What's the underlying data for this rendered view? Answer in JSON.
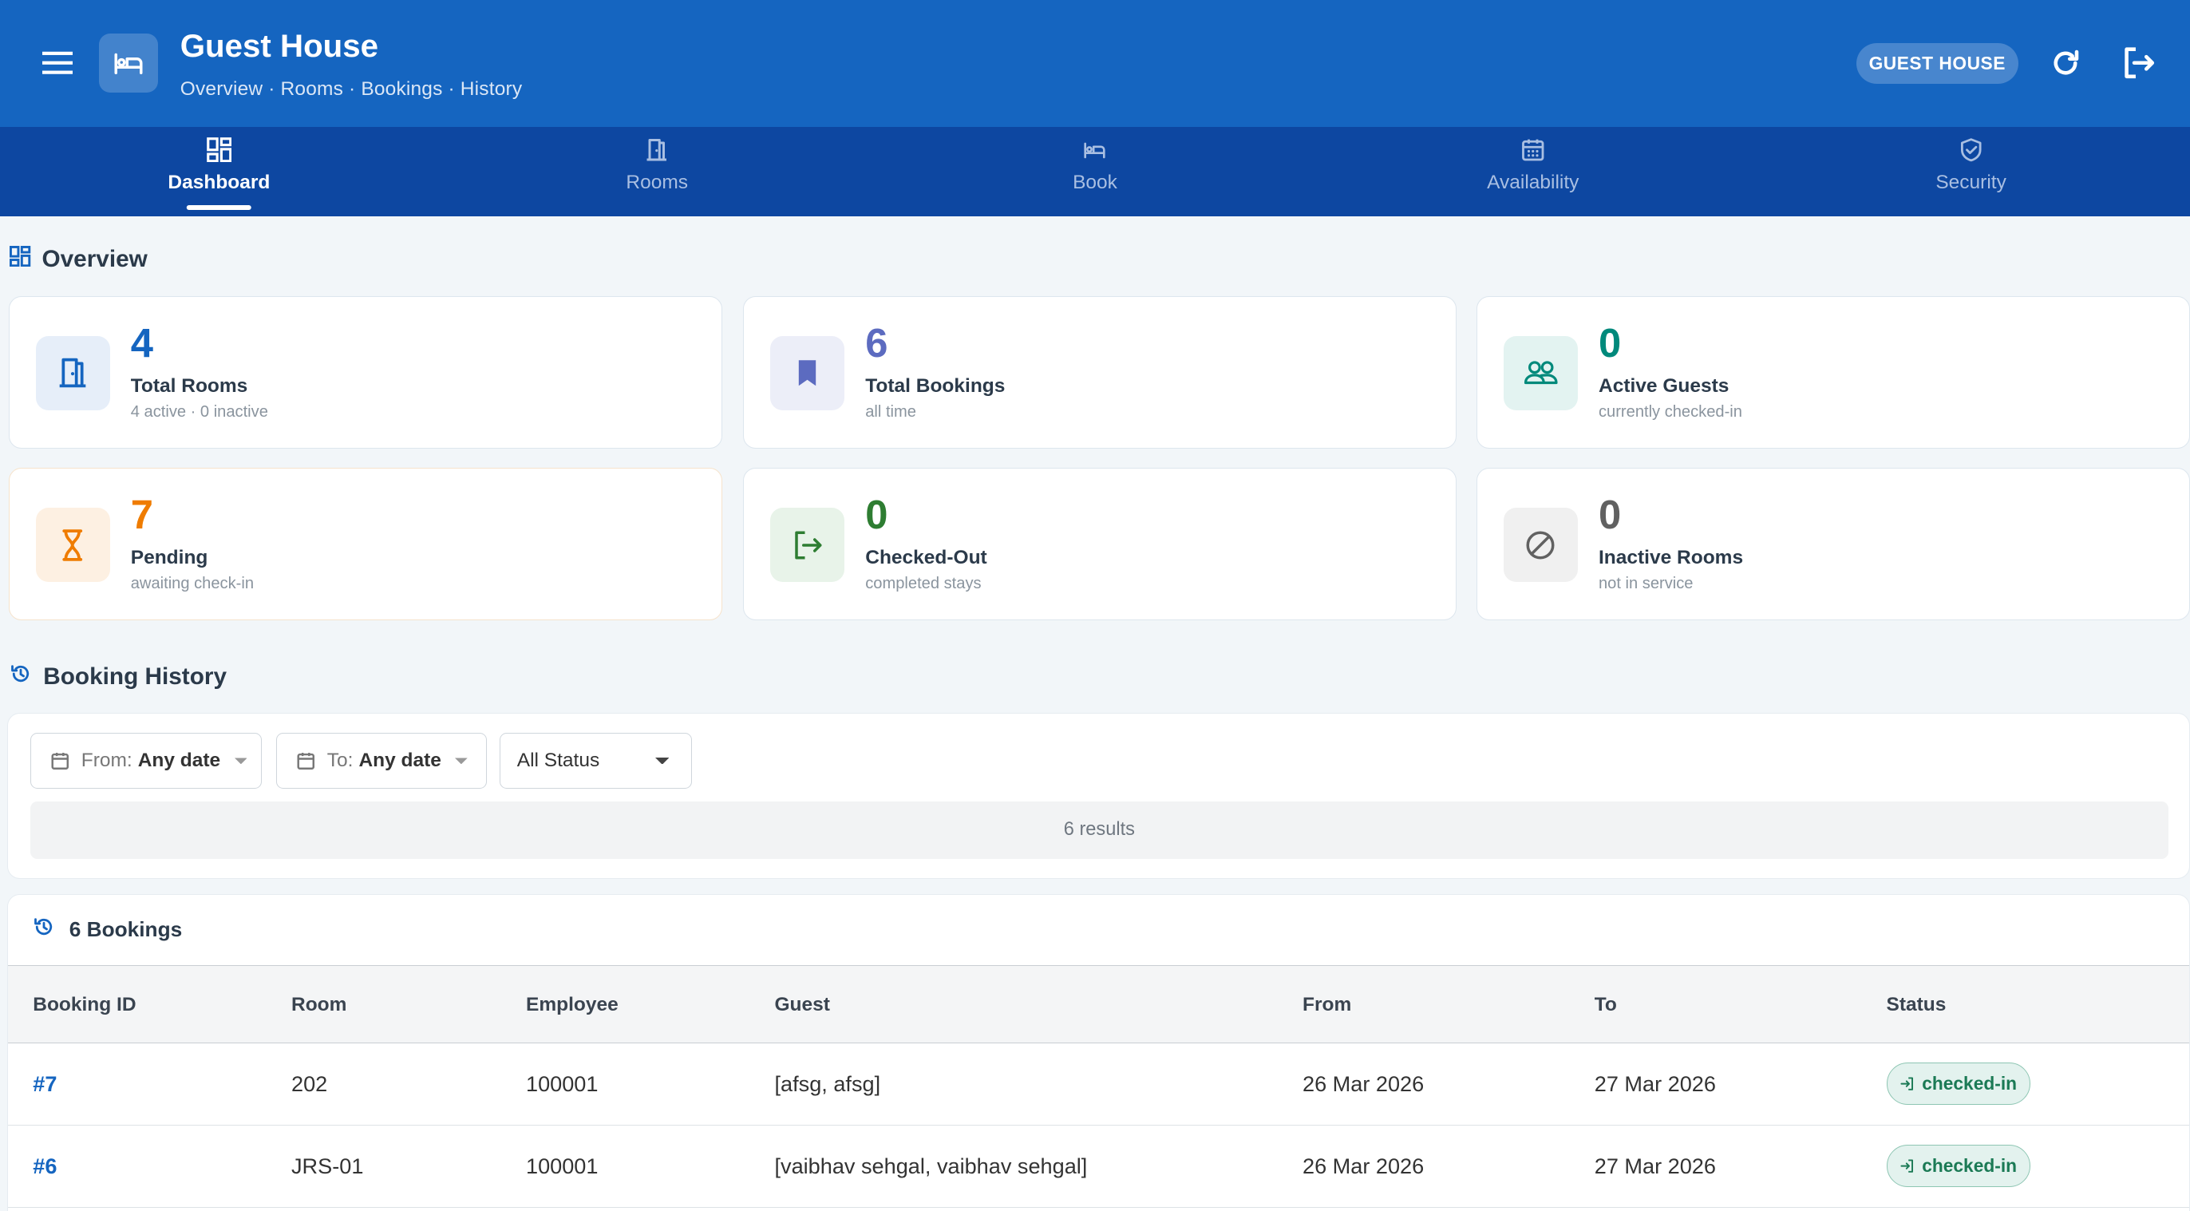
{
  "header": {
    "title": "Guest House",
    "subtitle": "Overview · Rooms · Bookings · History",
    "role_badge": "GUEST HOUSE"
  },
  "tabs": [
    {
      "label": "Dashboard",
      "icon": "dashboard-icon",
      "active": true
    },
    {
      "label": "Rooms",
      "icon": "door-icon",
      "active": false
    },
    {
      "label": "Book",
      "icon": "bed-icon",
      "active": false
    },
    {
      "label": "Availability",
      "icon": "calendar-icon",
      "active": false
    },
    {
      "label": "Security",
      "icon": "shield-icon",
      "active": false
    }
  ],
  "overview": {
    "title": "Overview",
    "cards": [
      {
        "value": "4",
        "label": "Total Rooms",
        "sub": "4 active · 0 inactive",
        "icon": "door-icon",
        "color": "#1565c0",
        "bg": "#e6eef9"
      },
      {
        "value": "6",
        "label": "Total Bookings",
        "sub": "all time",
        "icon": "bookmark-icon",
        "color": "#5c6bc0",
        "bg": "#eceef8"
      },
      {
        "value": "0",
        "label": "Active Guests",
        "sub": "currently checked-in",
        "icon": "people-icon",
        "color": "#00897b",
        "bg": "#e3f3f1"
      },
      {
        "value": "7",
        "label": "Pending",
        "sub": "awaiting check-in",
        "icon": "hourglass-icon",
        "color": "#ef7c00",
        "bg": "#fdf0e2"
      },
      {
        "value": "0",
        "label": "Checked-Out",
        "sub": "completed stays",
        "icon": "logout-icon",
        "color": "#2e7d32",
        "bg": "#e8f3e9"
      },
      {
        "value": "0",
        "label": "Inactive Rooms",
        "sub": "not in service",
        "icon": "block-icon",
        "color": "#616161",
        "bg": "#f0f0f0"
      }
    ]
  },
  "history": {
    "title": "Booking History",
    "filters": {
      "from_prefix": "From:",
      "from_value": "Any date",
      "to_prefix": "To:",
      "to_value": "Any date",
      "status_value": "All Status"
    },
    "results_text": "6 results"
  },
  "bookings": {
    "title": "6 Bookings",
    "columns": [
      "Booking ID",
      "Room",
      "Employee",
      "Guest",
      "From",
      "To",
      "Status"
    ],
    "rows": [
      {
        "id": "#7",
        "room": "202",
        "employee": "100001",
        "guest": "[afsg, afsg]",
        "from": "26 Mar 2026",
        "to": "27 Mar 2026",
        "status": "checked-in"
      },
      {
        "id": "#6",
        "room": "JRS-01",
        "employee": "100001",
        "guest": "[vaibhav sehgal, vaibhav sehgal]",
        "from": "26 Mar 2026",
        "to": "27 Mar 2026",
        "status": "checked-in"
      }
    ]
  }
}
